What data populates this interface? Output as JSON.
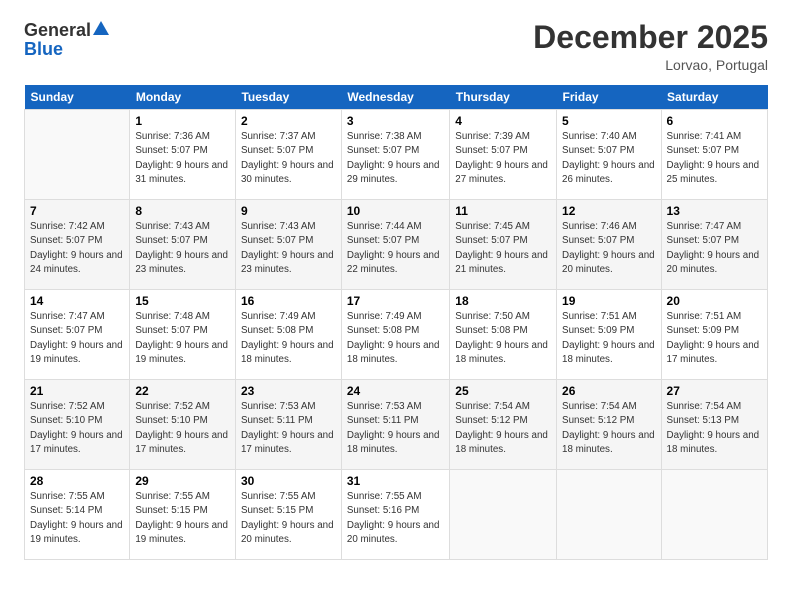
{
  "header": {
    "logo_general": "General",
    "logo_blue": "Blue",
    "month_year": "December 2025",
    "location": "Lorvao, Portugal"
  },
  "days_of_week": [
    "Sunday",
    "Monday",
    "Tuesday",
    "Wednesday",
    "Thursday",
    "Friday",
    "Saturday"
  ],
  "weeks": [
    [
      {
        "day": "",
        "sunrise": "",
        "sunset": "",
        "daylight": ""
      },
      {
        "day": "1",
        "sunrise": "Sunrise: 7:36 AM",
        "sunset": "Sunset: 5:07 PM",
        "daylight": "Daylight: 9 hours and 31 minutes."
      },
      {
        "day": "2",
        "sunrise": "Sunrise: 7:37 AM",
        "sunset": "Sunset: 5:07 PM",
        "daylight": "Daylight: 9 hours and 30 minutes."
      },
      {
        "day": "3",
        "sunrise": "Sunrise: 7:38 AM",
        "sunset": "Sunset: 5:07 PM",
        "daylight": "Daylight: 9 hours and 29 minutes."
      },
      {
        "day": "4",
        "sunrise": "Sunrise: 7:39 AM",
        "sunset": "Sunset: 5:07 PM",
        "daylight": "Daylight: 9 hours and 27 minutes."
      },
      {
        "day": "5",
        "sunrise": "Sunrise: 7:40 AM",
        "sunset": "Sunset: 5:07 PM",
        "daylight": "Daylight: 9 hours and 26 minutes."
      },
      {
        "day": "6",
        "sunrise": "Sunrise: 7:41 AM",
        "sunset": "Sunset: 5:07 PM",
        "daylight": "Daylight: 9 hours and 25 minutes."
      }
    ],
    [
      {
        "day": "7",
        "sunrise": "Sunrise: 7:42 AM",
        "sunset": "Sunset: 5:07 PM",
        "daylight": "Daylight: 9 hours and 24 minutes."
      },
      {
        "day": "8",
        "sunrise": "Sunrise: 7:43 AM",
        "sunset": "Sunset: 5:07 PM",
        "daylight": "Daylight: 9 hours and 23 minutes."
      },
      {
        "day": "9",
        "sunrise": "Sunrise: 7:43 AM",
        "sunset": "Sunset: 5:07 PM",
        "daylight": "Daylight: 9 hours and 23 minutes."
      },
      {
        "day": "10",
        "sunrise": "Sunrise: 7:44 AM",
        "sunset": "Sunset: 5:07 PM",
        "daylight": "Daylight: 9 hours and 22 minutes."
      },
      {
        "day": "11",
        "sunrise": "Sunrise: 7:45 AM",
        "sunset": "Sunset: 5:07 PM",
        "daylight": "Daylight: 9 hours and 21 minutes."
      },
      {
        "day": "12",
        "sunrise": "Sunrise: 7:46 AM",
        "sunset": "Sunset: 5:07 PM",
        "daylight": "Daylight: 9 hours and 20 minutes."
      },
      {
        "day": "13",
        "sunrise": "Sunrise: 7:47 AM",
        "sunset": "Sunset: 5:07 PM",
        "daylight": "Daylight: 9 hours and 20 minutes."
      }
    ],
    [
      {
        "day": "14",
        "sunrise": "Sunrise: 7:47 AM",
        "sunset": "Sunset: 5:07 PM",
        "daylight": "Daylight: 9 hours and 19 minutes."
      },
      {
        "day": "15",
        "sunrise": "Sunrise: 7:48 AM",
        "sunset": "Sunset: 5:07 PM",
        "daylight": "Daylight: 9 hours and 19 minutes."
      },
      {
        "day": "16",
        "sunrise": "Sunrise: 7:49 AM",
        "sunset": "Sunset: 5:08 PM",
        "daylight": "Daylight: 9 hours and 18 minutes."
      },
      {
        "day": "17",
        "sunrise": "Sunrise: 7:49 AM",
        "sunset": "Sunset: 5:08 PM",
        "daylight": "Daylight: 9 hours and 18 minutes."
      },
      {
        "day": "18",
        "sunrise": "Sunrise: 7:50 AM",
        "sunset": "Sunset: 5:08 PM",
        "daylight": "Daylight: 9 hours and 18 minutes."
      },
      {
        "day": "19",
        "sunrise": "Sunrise: 7:51 AM",
        "sunset": "Sunset: 5:09 PM",
        "daylight": "Daylight: 9 hours and 18 minutes."
      },
      {
        "day": "20",
        "sunrise": "Sunrise: 7:51 AM",
        "sunset": "Sunset: 5:09 PM",
        "daylight": "Daylight: 9 hours and 17 minutes."
      }
    ],
    [
      {
        "day": "21",
        "sunrise": "Sunrise: 7:52 AM",
        "sunset": "Sunset: 5:10 PM",
        "daylight": "Daylight: 9 hours and 17 minutes."
      },
      {
        "day": "22",
        "sunrise": "Sunrise: 7:52 AM",
        "sunset": "Sunset: 5:10 PM",
        "daylight": "Daylight: 9 hours and 17 minutes."
      },
      {
        "day": "23",
        "sunrise": "Sunrise: 7:53 AM",
        "sunset": "Sunset: 5:11 PM",
        "daylight": "Daylight: 9 hours and 17 minutes."
      },
      {
        "day": "24",
        "sunrise": "Sunrise: 7:53 AM",
        "sunset": "Sunset: 5:11 PM",
        "daylight": "Daylight: 9 hours and 18 minutes."
      },
      {
        "day": "25",
        "sunrise": "Sunrise: 7:54 AM",
        "sunset": "Sunset: 5:12 PM",
        "daylight": "Daylight: 9 hours and 18 minutes."
      },
      {
        "day": "26",
        "sunrise": "Sunrise: 7:54 AM",
        "sunset": "Sunset: 5:12 PM",
        "daylight": "Daylight: 9 hours and 18 minutes."
      },
      {
        "day": "27",
        "sunrise": "Sunrise: 7:54 AM",
        "sunset": "Sunset: 5:13 PM",
        "daylight": "Daylight: 9 hours and 18 minutes."
      }
    ],
    [
      {
        "day": "28",
        "sunrise": "Sunrise: 7:55 AM",
        "sunset": "Sunset: 5:14 PM",
        "daylight": "Daylight: 9 hours and 19 minutes."
      },
      {
        "day": "29",
        "sunrise": "Sunrise: 7:55 AM",
        "sunset": "Sunset: 5:15 PM",
        "daylight": "Daylight: 9 hours and 19 minutes."
      },
      {
        "day": "30",
        "sunrise": "Sunrise: 7:55 AM",
        "sunset": "Sunset: 5:15 PM",
        "daylight": "Daylight: 9 hours and 20 minutes."
      },
      {
        "day": "31",
        "sunrise": "Sunrise: 7:55 AM",
        "sunset": "Sunset: 5:16 PM",
        "daylight": "Daylight: 9 hours and 20 minutes."
      },
      {
        "day": "",
        "sunrise": "",
        "sunset": "",
        "daylight": ""
      },
      {
        "day": "",
        "sunrise": "",
        "sunset": "",
        "daylight": ""
      },
      {
        "day": "",
        "sunrise": "",
        "sunset": "",
        "daylight": ""
      }
    ]
  ]
}
